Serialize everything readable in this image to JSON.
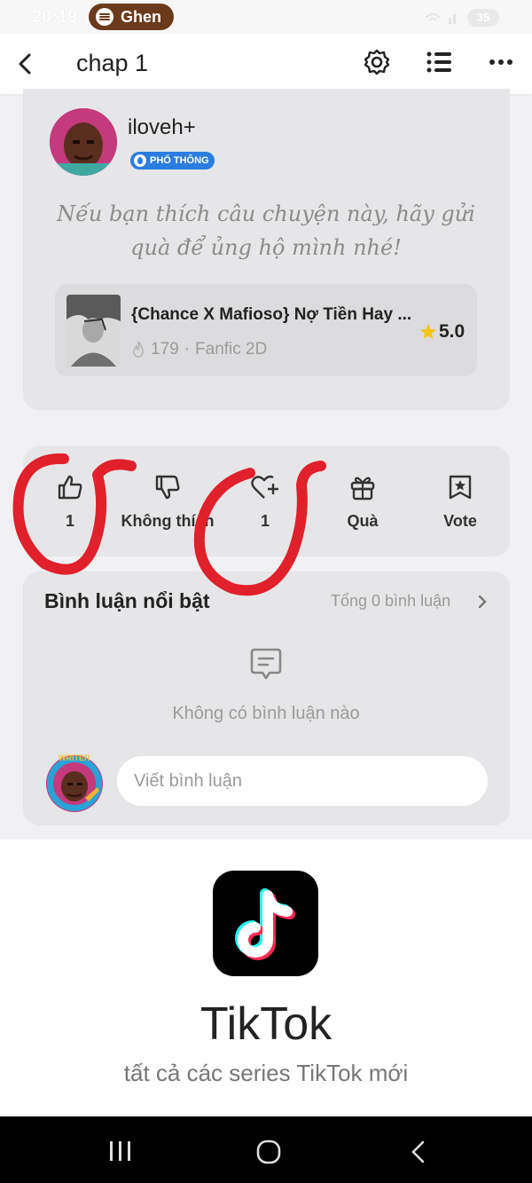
{
  "status_bar": {
    "time": "20:19",
    "media_app": "Ghen",
    "battery": "35"
  },
  "header": {
    "title": "chap 1"
  },
  "author": {
    "username": "iloveh+",
    "badge": "PHỔ THÔNG",
    "message": "Nếu bạn thích câu chuyện này, hãy gửi quà để ủng hộ mình nhé!"
  },
  "story": {
    "title": "{Chance X Mafioso} Nợ Tiền Hay ...",
    "reads": "179",
    "genre": "Fanfic 2D",
    "rating": "5.0"
  },
  "actions": [
    {
      "label": "1",
      "icon": "thumbs-up-icon"
    },
    {
      "label": "Không thích",
      "icon": "thumbs-down-icon"
    },
    {
      "label": "1",
      "icon": "heart-plus-icon"
    },
    {
      "label": "Quà",
      "icon": "gift-icon"
    },
    {
      "label": "Vote",
      "icon": "vote-star-icon"
    }
  ],
  "comments": {
    "title": "Bình luận nổi bật",
    "total": "Tổng 0 bình luận",
    "empty": "Không có bình luận nào",
    "input_placeholder": "Viết bình luận",
    "avatar_badge": "WRITER"
  },
  "ad": {
    "name": "TikTok",
    "tagline": "tất cả các series TikTok mới"
  },
  "colors": {
    "annotation_red": "#e0202a",
    "badge_blue": "#2b7de0",
    "tiktok_cyan": "#25f4ee",
    "tiktok_red": "#fe2c55"
  }
}
